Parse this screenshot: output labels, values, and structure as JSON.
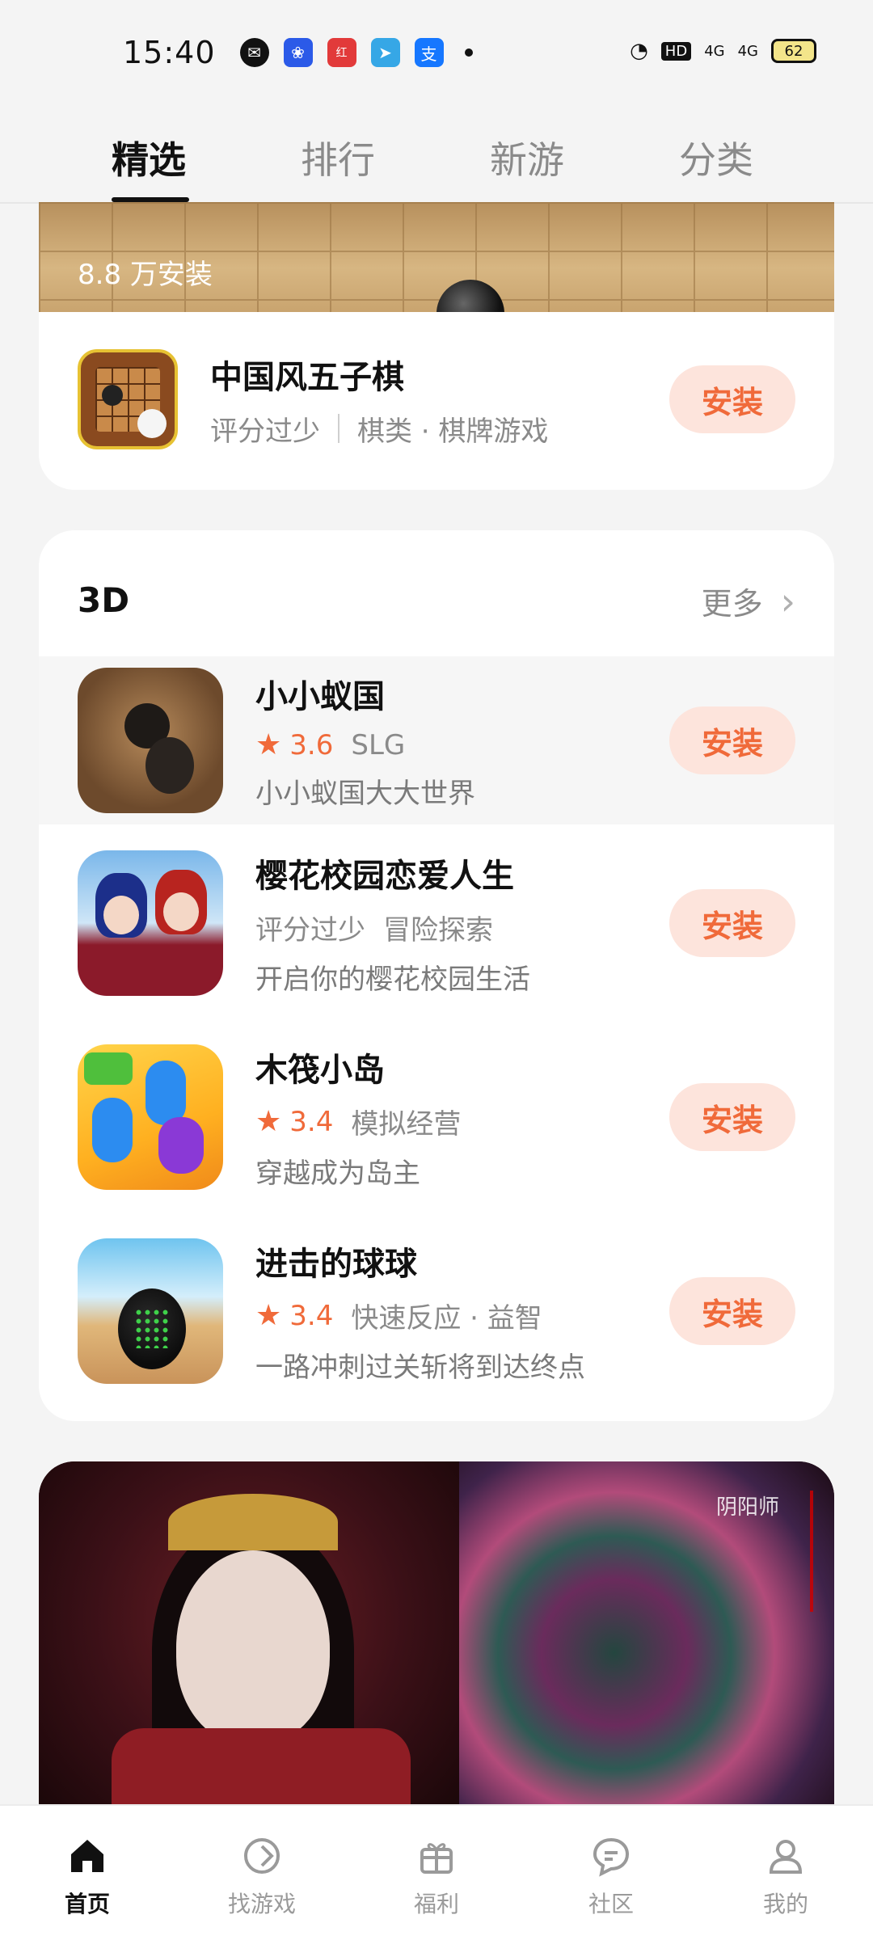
{
  "status_bar": {
    "time": "15:40",
    "notif_icons": [
      "wechat-icon",
      "baidu-icon",
      "xiaohongshu-icon",
      "telegram-icon",
      "alipay-icon"
    ],
    "network": [
      "4G",
      "4G"
    ],
    "hd_label": "HD",
    "battery": "62"
  },
  "tabs": [
    {
      "label": "精选",
      "active": true
    },
    {
      "label": "排行",
      "active": false
    },
    {
      "label": "新游",
      "active": false
    },
    {
      "label": "分类",
      "active": false
    }
  ],
  "featured_app": {
    "install_count": "8.8 万安装",
    "name": "中国风五子棋",
    "rating_text": "评分过少",
    "category": "棋类 · 棋牌游戏",
    "button": "安装"
  },
  "section": {
    "title": "3D",
    "more": "更多",
    "apps": [
      {
        "name": "小小蚁国",
        "rating": "3.6",
        "tag": "SLG",
        "desc": "小小蚁国大大世界",
        "button": "安装"
      },
      {
        "name": "樱花校园恋爱人生",
        "rating_text": "评分过少",
        "tag": "冒险探索",
        "desc": "开启你的樱花校园生活",
        "button": "安装"
      },
      {
        "name": "木筏小岛",
        "rating": "3.4",
        "tag": "模拟经营",
        "desc": "穿越成为岛主",
        "button": "安装"
      },
      {
        "name": "进击的球球",
        "rating": "3.4",
        "tag": "快速反应 · 益智",
        "desc": "一路冲刺过关斩将到达终点",
        "button": "安装"
      }
    ]
  },
  "banner_logo_text": "阴阳师",
  "bottom_nav": [
    {
      "label": "首页",
      "icon": "home-icon",
      "active": true
    },
    {
      "label": "找游戏",
      "icon": "find-game-icon",
      "active": false
    },
    {
      "label": "福利",
      "icon": "gift-icon",
      "active": false
    },
    {
      "label": "社区",
      "icon": "community-icon",
      "active": false
    },
    {
      "label": "我的",
      "icon": "profile-icon",
      "active": false
    }
  ],
  "colors": {
    "accent": "#f06a3a",
    "button_bg": "#fde4dc"
  }
}
